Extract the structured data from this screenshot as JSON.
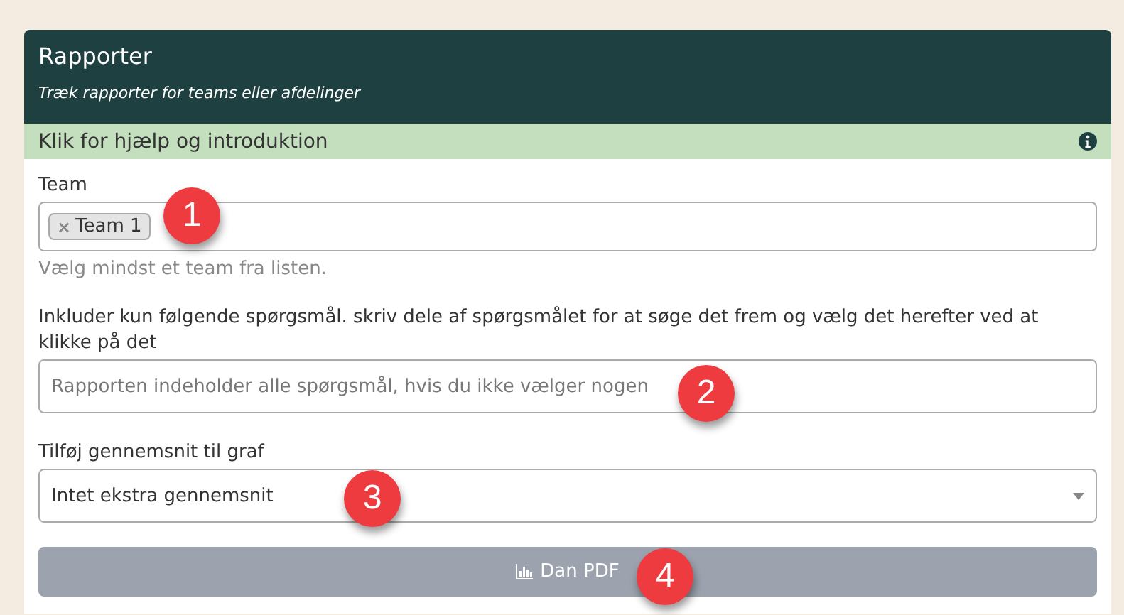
{
  "panel": {
    "title": "Rapporter",
    "subtitle": "Træk rapporter for teams eller afdelinger"
  },
  "help_bar": {
    "text": "Klik for hjælp og introduktion"
  },
  "team_field": {
    "label": "Team",
    "tags": [
      {
        "text": "Team 1",
        "remove": "×"
      }
    ],
    "help": "Vælg mindst et team fra listen."
  },
  "questions_field": {
    "label": "Inkluder kun følgende spørgsmål. skriv dele af spørgsmålet for at søge det frem og vælg det herefter ved at klikke på det",
    "placeholder": "Rapporten indeholder alle spørgsmål, hvis du ikke vælger nogen"
  },
  "average_field": {
    "label": "Tilføj gennemsnit til graf",
    "value": "Intet ekstra gennemsnit"
  },
  "pdf_button": {
    "label": "Dan PDF",
    "disabled": true
  },
  "callouts": [
    "1",
    "2",
    "3",
    "4"
  ]
}
